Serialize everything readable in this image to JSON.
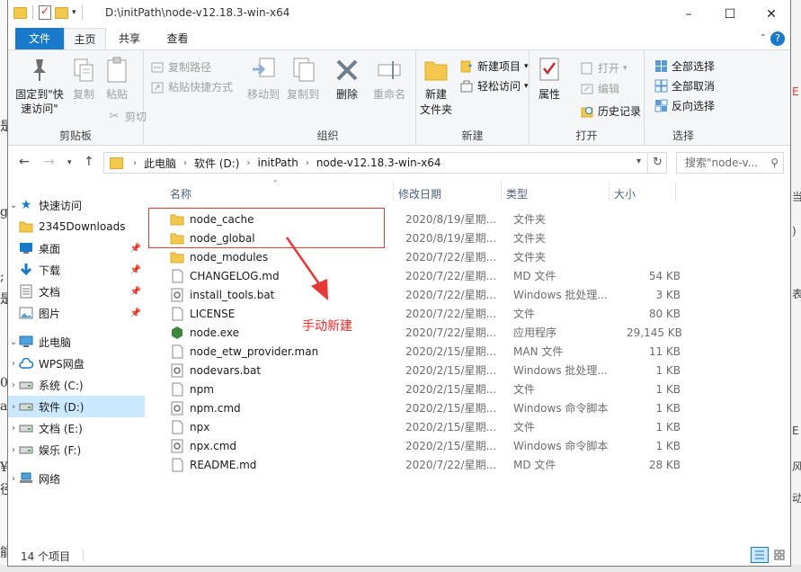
{
  "window": {
    "title": "D:\\initPath\\node-v12.18.3-win-x64"
  },
  "tabs": {
    "file": "文件",
    "home": "主页",
    "share": "共享",
    "view": "查看"
  },
  "ribbon": {
    "clipboard": {
      "label": "剪贴板",
      "pin": "固定到\"快速访问\"",
      "copy": "复制",
      "paste": "粘贴",
      "copy_path": "复制路径",
      "paste_shortcut": "粘贴快捷方式",
      "cut": "剪切"
    },
    "organize": {
      "label": "组织",
      "move_to": "移动到",
      "copy_to": "复制到",
      "delete": "删除",
      "rename": "重命名"
    },
    "new": {
      "label": "新建",
      "new_folder": "新建\n文件夹",
      "new_item": "新建项目",
      "easy_access": "轻松访问"
    },
    "open": {
      "label": "打开",
      "properties": "属性",
      "open": "打开",
      "edit": "编辑",
      "history": "历史记录"
    },
    "select": {
      "label": "选择",
      "select_all": "全部选择",
      "select_none": "全部取消",
      "invert": "反向选择"
    }
  },
  "address": {
    "crumbs": [
      "此电脑",
      "软件 (D:)",
      "initPath",
      "node-v12.18.3-win-x64"
    ],
    "search_placeholder": "搜索\"node-v..."
  },
  "nav": {
    "quick_access": "快速访问",
    "items": [
      {
        "label": "2345Downloads",
        "icon": "folder-icon",
        "pinned": false
      },
      {
        "label": "桌面",
        "icon": "desktop-icon",
        "pinned": true
      },
      {
        "label": "下载",
        "icon": "download-icon",
        "pinned": true
      },
      {
        "label": "文档",
        "icon": "document-icon",
        "pinned": true
      },
      {
        "label": "图片",
        "icon": "picture-icon",
        "pinned": true
      }
    ],
    "this_pc": "此电脑",
    "drives": [
      {
        "label": "WPS网盘",
        "icon": "cloud-icon",
        "selected": false
      },
      {
        "label": "系统 (C:)",
        "icon": "drive-icon",
        "selected": false
      },
      {
        "label": "软件 (D:)",
        "icon": "drive-icon",
        "selected": true
      },
      {
        "label": "文档 (E:)",
        "icon": "drive-icon",
        "selected": false
      },
      {
        "label": "娱乐 (F:)",
        "icon": "drive-icon",
        "selected": false
      }
    ],
    "network": "网络"
  },
  "columns": {
    "name": "名称",
    "date": "修改日期",
    "type": "类型",
    "size": "大小"
  },
  "files": [
    {
      "name": "node_cache",
      "date": "2020/8/19/星期...",
      "type": "文件夹",
      "size": "",
      "icon": "folder"
    },
    {
      "name": "node_global",
      "date": "2020/8/19/星期...",
      "type": "文件夹",
      "size": "",
      "icon": "folder"
    },
    {
      "name": "node_modules",
      "date": "2020/7/22/星期...",
      "type": "文件夹",
      "size": "",
      "icon": "folder"
    },
    {
      "name": "CHANGELOG.md",
      "date": "2020/7/22/星期...",
      "type": "MD 文件",
      "size": "54 KB",
      "icon": "file"
    },
    {
      "name": "install_tools.bat",
      "date": "2020/7/22/星期...",
      "type": "Windows 批处理...",
      "size": "3 KB",
      "icon": "bat"
    },
    {
      "name": "LICENSE",
      "date": "2020/7/22/星期...",
      "type": "文件",
      "size": "80 KB",
      "icon": "file"
    },
    {
      "name": "node.exe",
      "date": "2020/7/22/星期...",
      "type": "应用程序",
      "size": "29,145 KB",
      "icon": "exe"
    },
    {
      "name": "node_etw_provider.man",
      "date": "2020/2/15/星期...",
      "type": "MAN 文件",
      "size": "11 KB",
      "icon": "file"
    },
    {
      "name": "nodevars.bat",
      "date": "2020/2/15/星期...",
      "type": "Windows 批处理...",
      "size": "1 KB",
      "icon": "bat"
    },
    {
      "name": "npm",
      "date": "2020/2/15/星期...",
      "type": "文件",
      "size": "1 KB",
      "icon": "file"
    },
    {
      "name": "npm.cmd",
      "date": "2020/2/15/星期...",
      "type": "Windows 命令脚本",
      "size": "1 KB",
      "icon": "bat"
    },
    {
      "name": "npx",
      "date": "2020/2/15/星期...",
      "type": "文件",
      "size": "1 KB",
      "icon": "file"
    },
    {
      "name": "npx.cmd",
      "date": "2020/2/15/星期...",
      "type": "Windows 命令脚本",
      "size": "1 KB",
      "icon": "bat"
    },
    {
      "name": "README.md",
      "date": "2020/7/22/星期...",
      "type": "MD 文件",
      "size": "28 KB",
      "icon": "file"
    }
  ],
  "annotation": "手动新建",
  "status": {
    "count": "14 个项目"
  },
  "colors": {
    "accent": "#1979ca",
    "selection": "#cce8ff",
    "annotation": "#e53935",
    "folder": "#f3c84d"
  }
}
